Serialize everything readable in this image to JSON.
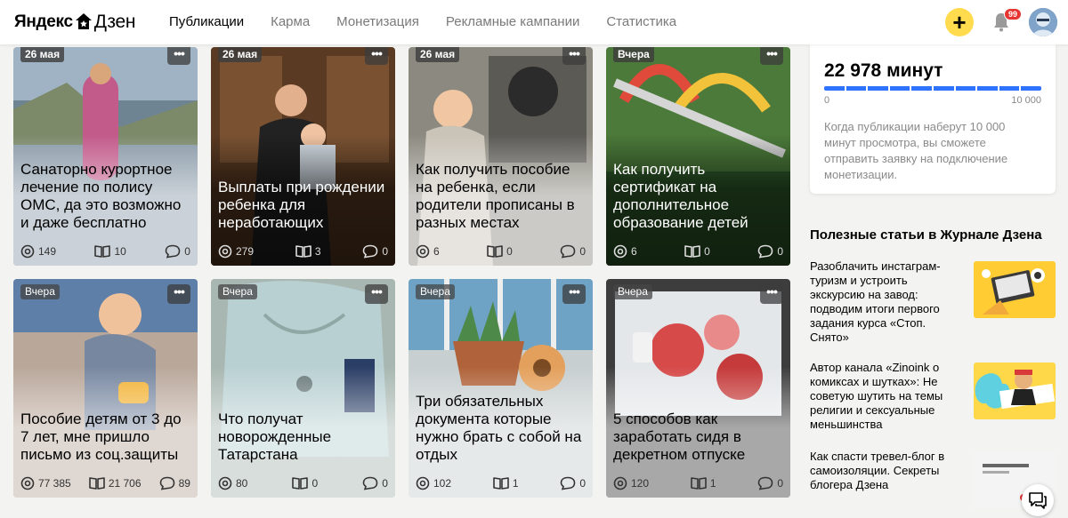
{
  "header": {
    "logo_brand": "Яндекс",
    "logo_product": "Дзен",
    "nav": [
      "Публикации",
      "Карма",
      "Монетизация",
      "Рекламные кампании",
      "Статистика"
    ],
    "notifications_count": "99",
    "plus_label": "+"
  },
  "cards": [
    {
      "date": "26 мая",
      "title": "Санаторно курортное лечение по полису ОМС, да это возможно и даже бесплатно",
      "views": "149",
      "reads": "10",
      "comments": "0"
    },
    {
      "date": "26 мая",
      "title": "Выплаты при рождении ребенка для неработающих",
      "views": "279",
      "reads": "3",
      "comments": "0"
    },
    {
      "date": "26 мая",
      "title": "Как получить пособие на ребенка, если родители прописаны в разных местах",
      "views": "6",
      "reads": "0",
      "comments": "0"
    },
    {
      "date": "Вчера",
      "title": "Как получить сертификат на дополнительное образование детей",
      "views": "6",
      "reads": "0",
      "comments": "0"
    },
    {
      "date": "Вчера",
      "title": "Пособие детям от 3 до 7 лет, мне пришло письмо из соц.защиты",
      "views": "77 385",
      "reads": "21 706",
      "comments": "89"
    },
    {
      "date": "Вчера",
      "title": "Что получат новорожденные Татарстана",
      "views": "80",
      "reads": "0",
      "comments": "0"
    },
    {
      "date": "Вчера",
      "title": "Три обязательных документа которые нужно брать с собой на отдых",
      "views": "102",
      "reads": "1",
      "comments": "0"
    },
    {
      "date": "Вчера",
      "title": "5 способов как заработать сидя в декретном отпуске",
      "views": "120",
      "reads": "1",
      "comments": "0"
    }
  ],
  "monetization": {
    "minutes": "22 978 минут",
    "progress_fraction": 1.0,
    "min_label": "0",
    "max_label": "10 000",
    "description": "Когда публикации наберут 10 000 минут просмотра, вы сможете отправить заявку на подключение монетизации."
  },
  "useful": {
    "title": "Полезные статьи в Журнале Дзена",
    "articles": [
      {
        "text": "Разоблачить инстаграм-туризм и устроить экскурсию на завод: подводим итоги первого задания курса «Стоп. Снято»"
      },
      {
        "text": "Автор канала «Zinoink о комиксах и шутках»: Не советую шутить на темы религии и сексуальные меньшинства"
      },
      {
        "text": "Как спасти тревел-блог в самоизоляции. Секреты блогера Дзена"
      }
    ]
  },
  "colors": {
    "accent_yellow": "#ffdb4d",
    "progress_blue": "#2e72ff",
    "badge_red": "#e63430"
  }
}
